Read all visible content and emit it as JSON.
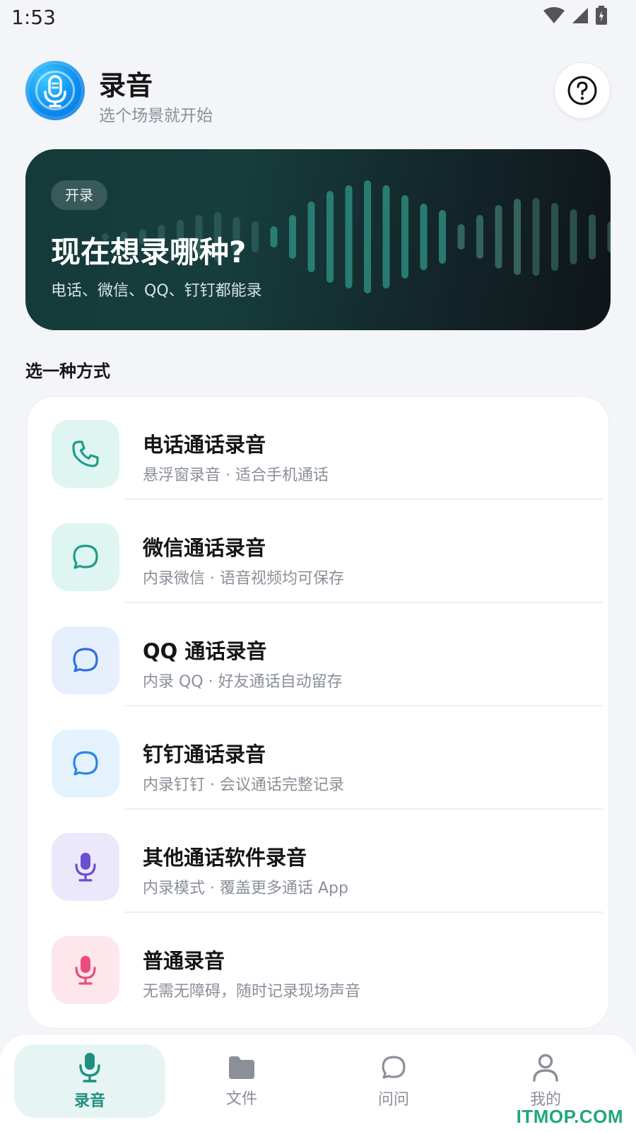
{
  "status_bar": {
    "time": "1:53"
  },
  "header": {
    "title": "录音",
    "subtitle": "选个场景就开始"
  },
  "banner": {
    "tag": "开录",
    "headline": "现在想录哪种?",
    "description": "电话、微信、QQ、钉钉都能录"
  },
  "section_title": "选一种方式",
  "options": [
    {
      "title": "电话通话录音",
      "desc": "悬浮窗录音 · 适合手机通话",
      "icon": "phone-icon",
      "bg": "#dff5f1",
      "color": "#1f9c8a"
    },
    {
      "title": "微信通话录音",
      "desc": "内录微信 · 语音视频均可保存",
      "icon": "chat-bubble-icon",
      "bg": "#dff5f1",
      "color": "#1f9c8a"
    },
    {
      "title": "QQ 通话录音",
      "desc": "内录 QQ · 好友通话自动留存",
      "icon": "chat-bubble-icon",
      "bg": "#e6f0fd",
      "color": "#2f6fe0"
    },
    {
      "title": "钉钉通话录音",
      "desc": "内录钉钉 · 会议通话完整记录",
      "icon": "chat-bubble-icon",
      "bg": "#e4f2fd",
      "color": "#2688e6"
    },
    {
      "title": "其他通话软件录音",
      "desc": "内录模式 · 覆盖更多通话 App",
      "icon": "microphone-icon",
      "bg": "#ece8fb",
      "color": "#6a4fd0"
    },
    {
      "title": "普通录音",
      "desc": "无需无障碍，随时记录现场声音",
      "icon": "microphone-icon",
      "bg": "#fde6ec",
      "color": "#ea4d7c"
    }
  ],
  "tabs": [
    {
      "label": "录音",
      "icon": "microphone-icon",
      "active": true
    },
    {
      "label": "文件",
      "icon": "folder-icon",
      "active": false
    },
    {
      "label": "问问",
      "icon": "chat-bubble-icon",
      "active": false
    },
    {
      "label": "我的",
      "icon": "user-icon",
      "active": false
    }
  ],
  "watermark": "ITMOP.COM",
  "colors": {
    "accent": "#1f8f80",
    "banner_bg": "#153a3a",
    "page_bg": "#f4f5f8"
  }
}
